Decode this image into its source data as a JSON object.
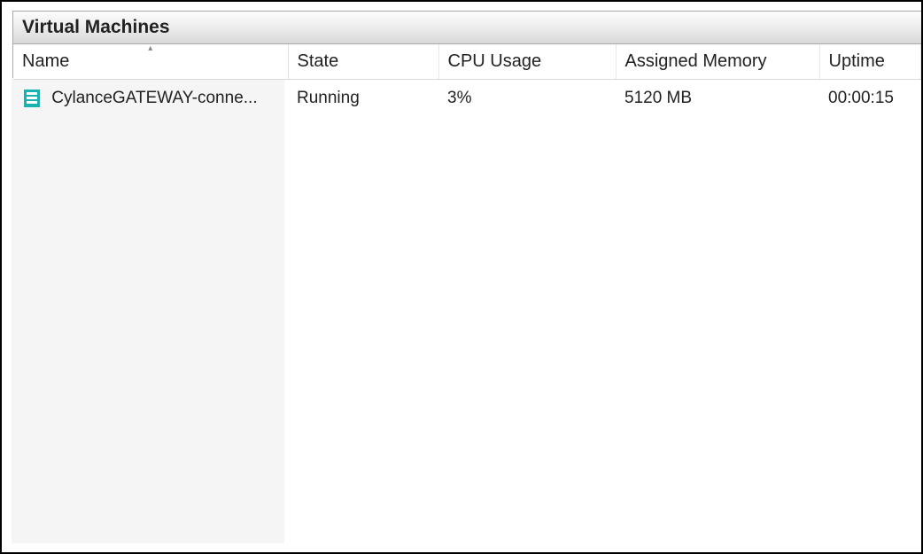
{
  "panel": {
    "title": "Virtual Machines"
  },
  "headers": {
    "name": "Name",
    "state": "State",
    "cpu": "CPU Usage",
    "memory": "Assigned Memory",
    "uptime": "Uptime"
  },
  "rows": [
    {
      "name": "CylanceGATEWAY-conne...",
      "state": "Running",
      "cpu": "3%",
      "memory": "5120 MB",
      "uptime": "00:00:15"
    }
  ]
}
